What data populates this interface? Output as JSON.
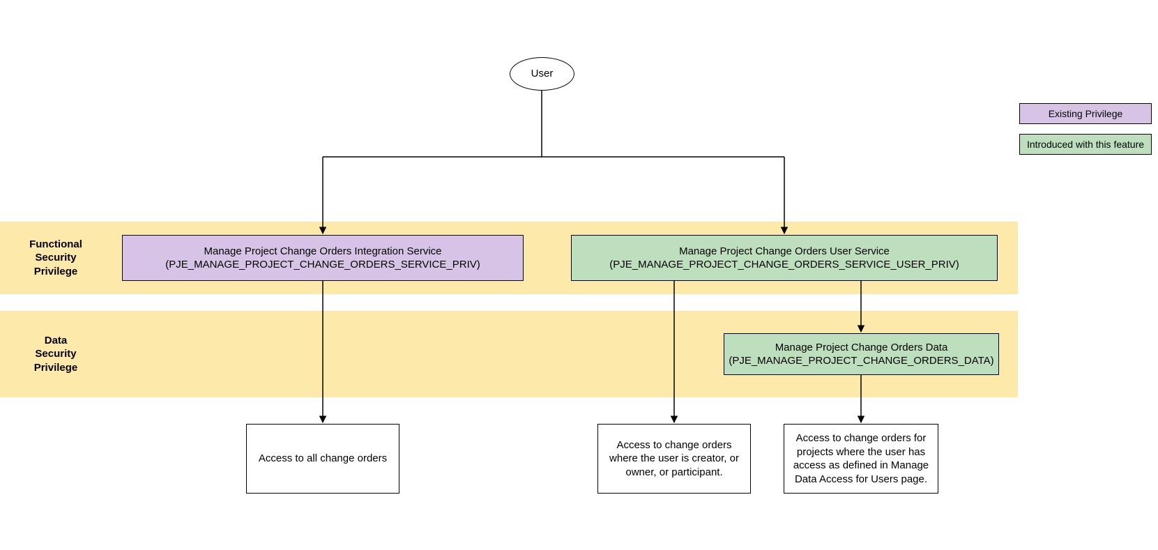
{
  "user_node": "User",
  "bands": {
    "functional": "Functional\nSecurity\nPrivilege",
    "data": "Data\nSecurity\nPrivilege"
  },
  "functional": {
    "integration": {
      "title": "Manage Project Change Orders Integration Service",
      "code": "(PJE_MANAGE_PROJECT_CHANGE_ORDERS_SERVICE_PRIV)"
    },
    "user": {
      "title": "Manage Project Change Orders User Service",
      "code": "(PJE_MANAGE_PROJECT_CHANGE_ORDERS_SERVICE_USER_PRIV)"
    }
  },
  "data_priv": {
    "title": "Manage Project Change Orders Data",
    "code": "(PJE_MANAGE_PROJECT_CHANGE_ORDERS_DATA)"
  },
  "outcomes": {
    "all": "Access to all change orders",
    "user": "Access to change orders where the user is creator, or owner, or participant.",
    "data_access": "Access to change orders for projects where the user has access as defined in Manage Data Access for Users page."
  },
  "legend": {
    "existing": "Existing Privilege",
    "introduced": "Introduced with this feature"
  }
}
